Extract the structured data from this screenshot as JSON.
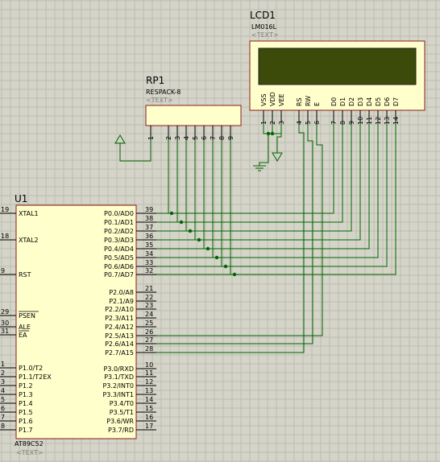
{
  "lcd": {
    "name": "LCD1",
    "model": "LM016L",
    "text_tag": "<TEXT>",
    "display_color": "#3c4a0a",
    "pin_labels": [
      "VSS",
      "VDD",
      "VEE",
      "RS",
      "RW",
      "E",
      "D0",
      "D1",
      "D2",
      "D3",
      "D4",
      "D5",
      "D6",
      "D7"
    ],
    "pin_numbers": [
      "1",
      "2",
      "3",
      "4",
      "5",
      "6",
      "7",
      "8",
      "9",
      "10",
      "11",
      "12",
      "13",
      "14"
    ]
  },
  "rp": {
    "name": "RP1",
    "model": "RESPACK-8",
    "text_tag": "<TEXT>",
    "pin_numbers": [
      "1",
      "2",
      "3",
      "4",
      "5",
      "6",
      "7",
      "8",
      "9"
    ]
  },
  "mcu": {
    "name": "U1",
    "model": "AT89C52",
    "text_tag": "<TEXT>",
    "left_pins": [
      {
        "num": "19",
        "label": "XTAL1"
      },
      {
        "num": "18",
        "label": "XTAL2"
      },
      {
        "num": "9",
        "label": "RST"
      },
      {
        "num": "29",
        "label": "PSEN"
      },
      {
        "num": "30",
        "label": "ALE"
      },
      {
        "num": "31",
        "label": "EA"
      },
      {
        "num": "1",
        "label": "P1.0/T2"
      },
      {
        "num": "2",
        "label": "P1.1/T2EX"
      },
      {
        "num": "3",
        "label": "P1.2"
      },
      {
        "num": "4",
        "label": "P1.3"
      },
      {
        "num": "5",
        "label": "P1.4"
      },
      {
        "num": "6",
        "label": "P1.5"
      },
      {
        "num": "7",
        "label": "P1.6"
      },
      {
        "num": "8",
        "label": "P1.7"
      }
    ],
    "right_pins": [
      {
        "num": "39",
        "label": "P0.0/AD0"
      },
      {
        "num": "38",
        "label": "P0.1/AD1"
      },
      {
        "num": "37",
        "label": "P0.2/AD2"
      },
      {
        "num": "36",
        "label": "P0.3/AD3"
      },
      {
        "num": "35",
        "label": "P0.4/AD4"
      },
      {
        "num": "34",
        "label": "P0.5/AD5"
      },
      {
        "num": "33",
        "label": "P0.6/AD6"
      },
      {
        "num": "32",
        "label": "P0.7/AD7"
      },
      {
        "num": "21",
        "label": "P2.0/A8"
      },
      {
        "num": "22",
        "label": "P2.1/A9"
      },
      {
        "num": "23",
        "label": "P2.2/A10"
      },
      {
        "num": "24",
        "label": "P2.3/A11"
      },
      {
        "num": "25",
        "label": "P2.4/A12"
      },
      {
        "num": "26",
        "label": "P2.5/A13"
      },
      {
        "num": "27",
        "label": "P2.6/A14"
      },
      {
        "num": "28",
        "label": "P2.7/A15"
      },
      {
        "num": "10",
        "label": "P3.0/RXD"
      },
      {
        "num": "11",
        "label": "P3.1/TXD"
      },
      {
        "num": "12",
        "label": "P3.2/INT0"
      },
      {
        "num": "13",
        "label": "P3.3/INT1"
      },
      {
        "num": "14",
        "label": "P3.4/T0"
      },
      {
        "num": "15",
        "label": "P3.5/T1"
      },
      {
        "num": "16",
        "label": "P3.6/WR"
      },
      {
        "num": "17",
        "label": "P3.7/RD"
      }
    ]
  },
  "colors": {
    "background": "#d4d4c8",
    "grid": "#bcbcb0",
    "component_outline": "#8b1a1a",
    "component_fill": "#ffffcc",
    "wire": "#006400",
    "text": "#000000",
    "tag_text": "#808080"
  }
}
